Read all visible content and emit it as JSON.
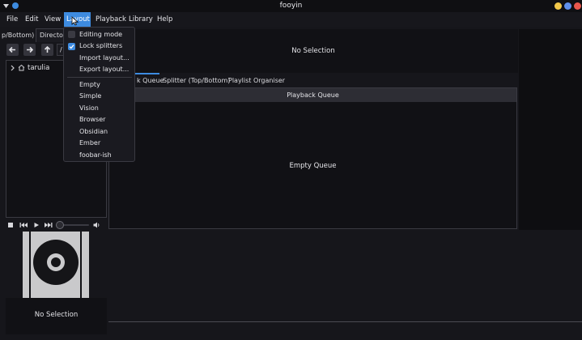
{
  "window": {
    "title": "fooyin"
  },
  "menubar": {
    "items": [
      {
        "label": "File"
      },
      {
        "label": "Edit"
      },
      {
        "label": "View"
      },
      {
        "label": "Layout"
      },
      {
        "label": "Playback"
      },
      {
        "label": "Library"
      },
      {
        "label": "Help"
      }
    ]
  },
  "layout_menu": {
    "editing_mode": {
      "label": "Editing mode",
      "checked": false
    },
    "lock_splitters": {
      "label": "Lock splitters",
      "checked": true
    },
    "import_layout": "Import layout...",
    "export_layout": "Export layout...",
    "presets": [
      "Empty",
      "Simple",
      "Vision",
      "Browser",
      "Obsidian",
      "Ember",
      "foobar-ish"
    ]
  },
  "left_tabs": [
    "p/Bottom)",
    "Directory"
  ],
  "dir_nav": {
    "path_prefix": "/",
    "tree_root": "tarulia"
  },
  "top_info": {
    "text": "No Selection"
  },
  "center_tabs": [
    "k Queue",
    "Splitter (Top/Bottom)",
    "Playlist Organiser"
  ],
  "queue": {
    "header": "Playback Queue",
    "empty_text": "Empty Queue"
  },
  "bottom_info": {
    "text": "No Selection"
  },
  "colors": {
    "accent": "#3d8be0",
    "background": "#16161b",
    "panel": "#111115"
  },
  "icons": {
    "back": "arrow-left-icon",
    "forward": "arrow-right-icon",
    "up": "arrow-up-icon",
    "stop": "stop-icon",
    "prev": "skip-previous-icon",
    "play": "play-icon",
    "next": "skip-next-icon",
    "volume": "volume-icon",
    "home": "home-icon"
  }
}
